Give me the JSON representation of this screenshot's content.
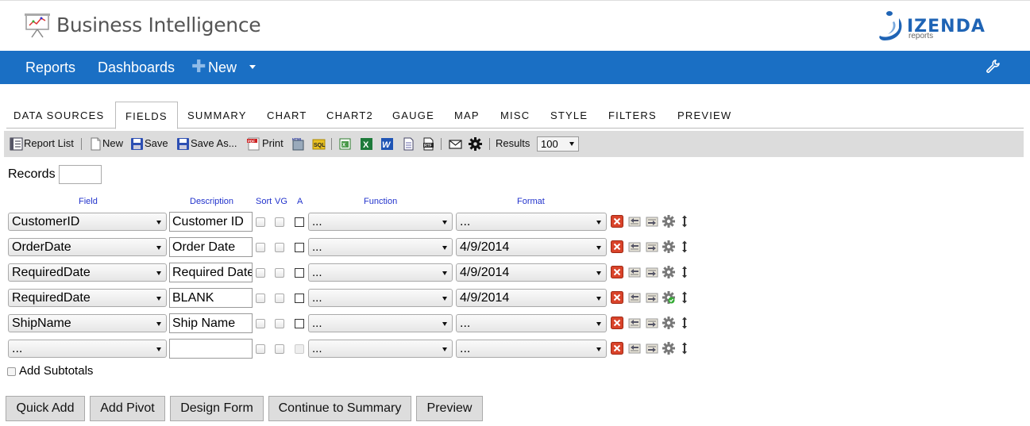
{
  "header": {
    "title": "Business Intelligence",
    "logo_icon": "presentation-chart-icon",
    "brand": {
      "name": "IZENDA",
      "sub": "reports"
    }
  },
  "nav": {
    "items": [
      "Reports",
      "Dashboards"
    ],
    "new_label": "New",
    "settings_icon": "wrench-icon",
    "bar_color": "#1a6fc4"
  },
  "tabs": {
    "items": [
      "DATA SOURCES",
      "FIELDS",
      "SUMMARY",
      "CHART",
      "CHART2",
      "GAUGE",
      "MAP",
      "MISC",
      "STYLE",
      "FILTERS",
      "PREVIEW"
    ],
    "active": "FIELDS"
  },
  "toolbar": {
    "report_list": "Report List",
    "new": "New",
    "save": "Save",
    "save_as": "Save As...",
    "print": "Print",
    "results_label": "Results",
    "results_value": "100",
    "icons": [
      "report-list-icon",
      "new-icon",
      "save-icon",
      "save-as-icon",
      "pdf-print-icon",
      "html-icon",
      "sql-icon",
      "csv-icon",
      "excel-icon",
      "word-icon",
      "doc-icon",
      "rtf-icon",
      "email-icon",
      "gear-icon"
    ]
  },
  "records": {
    "label": "Records",
    "value": ""
  },
  "columns": {
    "field": "Field",
    "description": "Description",
    "sort": "Sort",
    "vg": "VG",
    "a": "A",
    "function": "Function",
    "format": "Format"
  },
  "rows": [
    {
      "field": "CustomerID",
      "description": "Customer ID",
      "function": "...",
      "format": "..."
    },
    {
      "field": "OrderDate",
      "description": "Order Date",
      "function": "...",
      "format": "4/9/2014"
    },
    {
      "field": "RequiredDate",
      "description": "Required Date",
      "function": "...",
      "format": "4/9/2014"
    },
    {
      "field": "RequiredDate",
      "description": "BLANK",
      "function": "...",
      "format": "4/9/2014"
    },
    {
      "field": "ShipName",
      "description": "Ship Name",
      "function": "...",
      "format": "..."
    },
    {
      "field": "...",
      "description": "",
      "function": "...",
      "format": "..."
    }
  ],
  "row_icons": [
    "delete-icon",
    "move-up-icon",
    "move-down-icon",
    "field-settings-icon",
    "drag-handle-icon"
  ],
  "add_subtotals": "Add Subtotals",
  "buttons": {
    "quick_add": "Quick Add",
    "add_pivot": "Add Pivot",
    "design_form": "Design Form",
    "continue_summary": "Continue to Summary",
    "preview": "Preview"
  }
}
